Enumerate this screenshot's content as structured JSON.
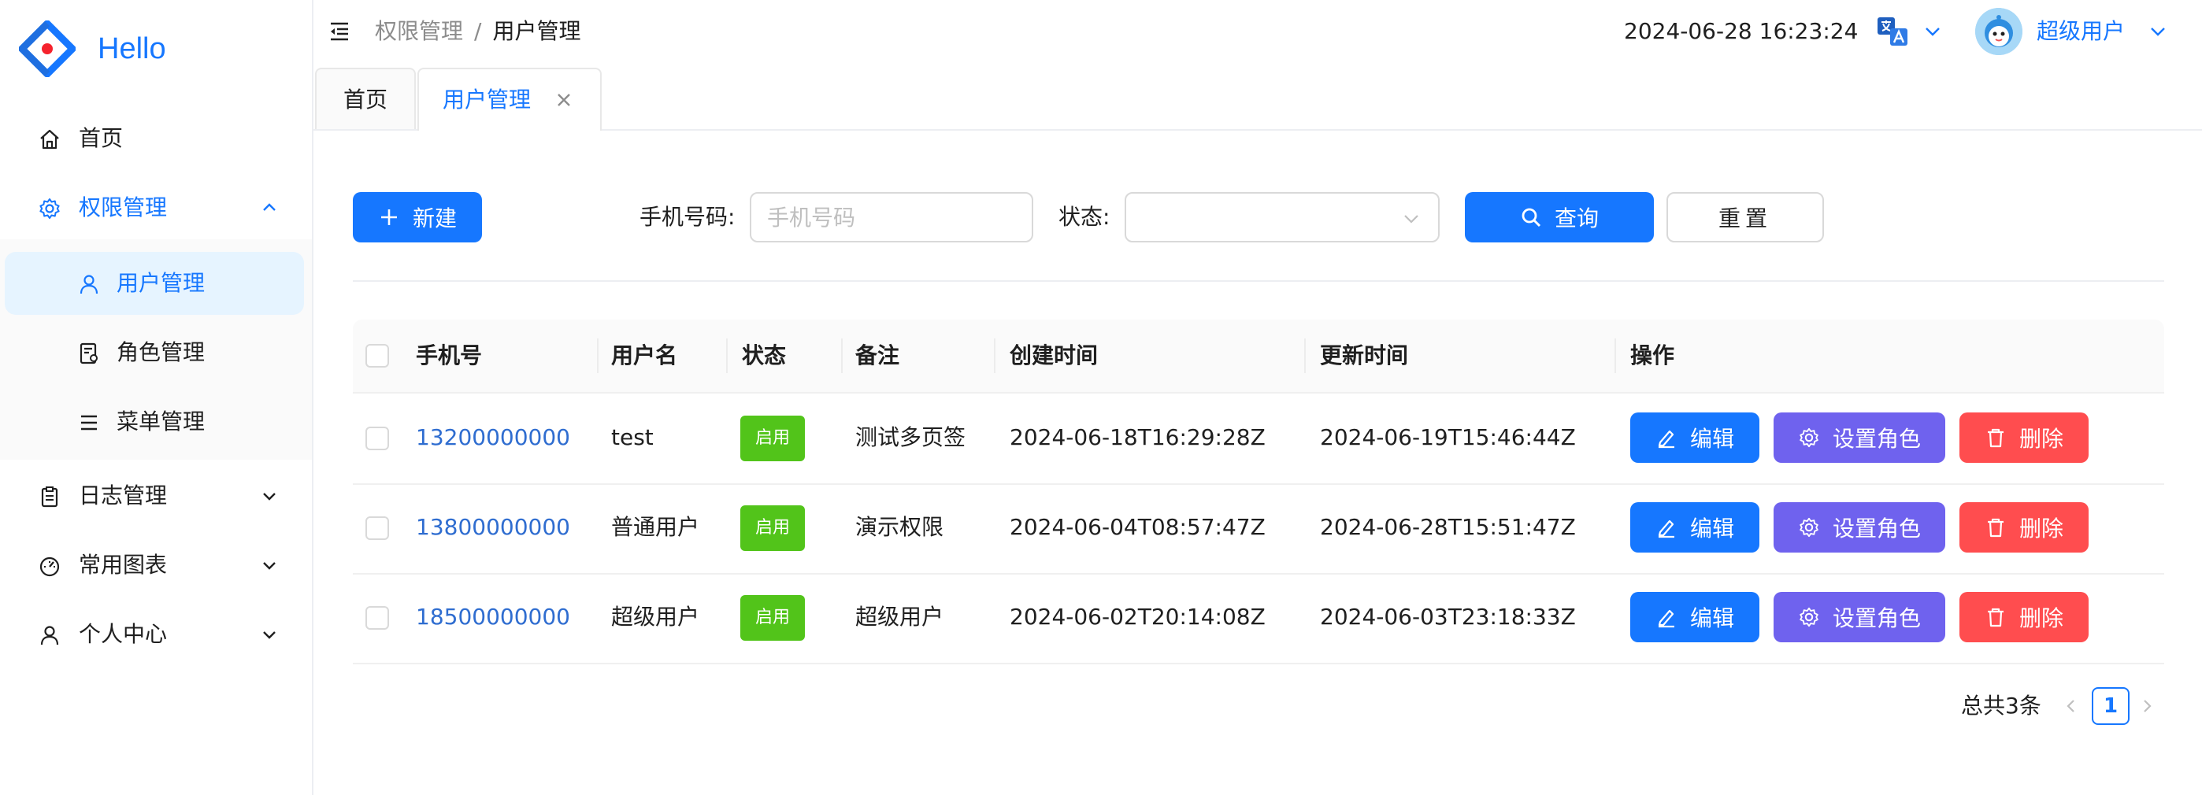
{
  "app": {
    "brand": "Hello"
  },
  "sidebar": {
    "items": [
      {
        "label": "首页",
        "icon": "home-icon"
      },
      {
        "label": "权限管理",
        "icon": "gear-icon",
        "expanded": true,
        "children": [
          {
            "label": "用户管理",
            "icon": "user-icon",
            "active": true
          },
          {
            "label": "角色管理",
            "icon": "role-icon"
          },
          {
            "label": "菜单管理",
            "icon": "menu-list-icon"
          }
        ]
      },
      {
        "label": "日志管理",
        "icon": "clipboard-icon"
      },
      {
        "label": "常用图表",
        "icon": "dashboard-icon"
      },
      {
        "label": "个人中心",
        "icon": "user-icon"
      }
    ]
  },
  "header": {
    "breadcrumb": [
      "权限管理",
      "用户管理"
    ],
    "separator": "/",
    "datetime": "2024-06-28 16:23:24",
    "user_name": "超级用户"
  },
  "tabs": [
    {
      "label": "首页",
      "active": false
    },
    {
      "label": "用户管理",
      "active": true,
      "closable": true
    }
  ],
  "toolbar": {
    "new_label": "新建",
    "phone_label": "手机号码:",
    "phone_placeholder": "手机号码",
    "phone_value": "",
    "status_label": "状态:",
    "status_value": "",
    "search_label": "查询",
    "reset_label": "重置"
  },
  "table": {
    "columns": [
      "手机号",
      "用户名",
      "状态",
      "备注",
      "创建时间",
      "更新时间",
      "操作"
    ],
    "rows": [
      {
        "phone": "13200000000",
        "username": "test",
        "status": "启用",
        "remark": "测试多页签",
        "created": "2024-06-18T16:29:28Z",
        "updated": "2024-06-19T15:46:44Z"
      },
      {
        "phone": "13800000000",
        "username": "普通用户",
        "status": "启用",
        "remark": "演示权限",
        "created": "2024-06-04T08:57:47Z",
        "updated": "2024-06-28T15:51:47Z"
      },
      {
        "phone": "18500000000",
        "username": "超级用户",
        "status": "启用",
        "remark": "超级用户",
        "created": "2024-06-02T20:14:08Z",
        "updated": "2024-06-03T23:18:33Z"
      }
    ],
    "actions": {
      "edit": "编辑",
      "set_role": "设置角色",
      "delete": "删除"
    }
  },
  "pagination": {
    "total_text": "总共3条",
    "current_page": "1"
  },
  "colors": {
    "primary": "#1677ff",
    "role_button": "#6f62ee",
    "danger": "#ff4d4f",
    "status_tag": "#52c41a",
    "link": "#2f6dd0"
  }
}
